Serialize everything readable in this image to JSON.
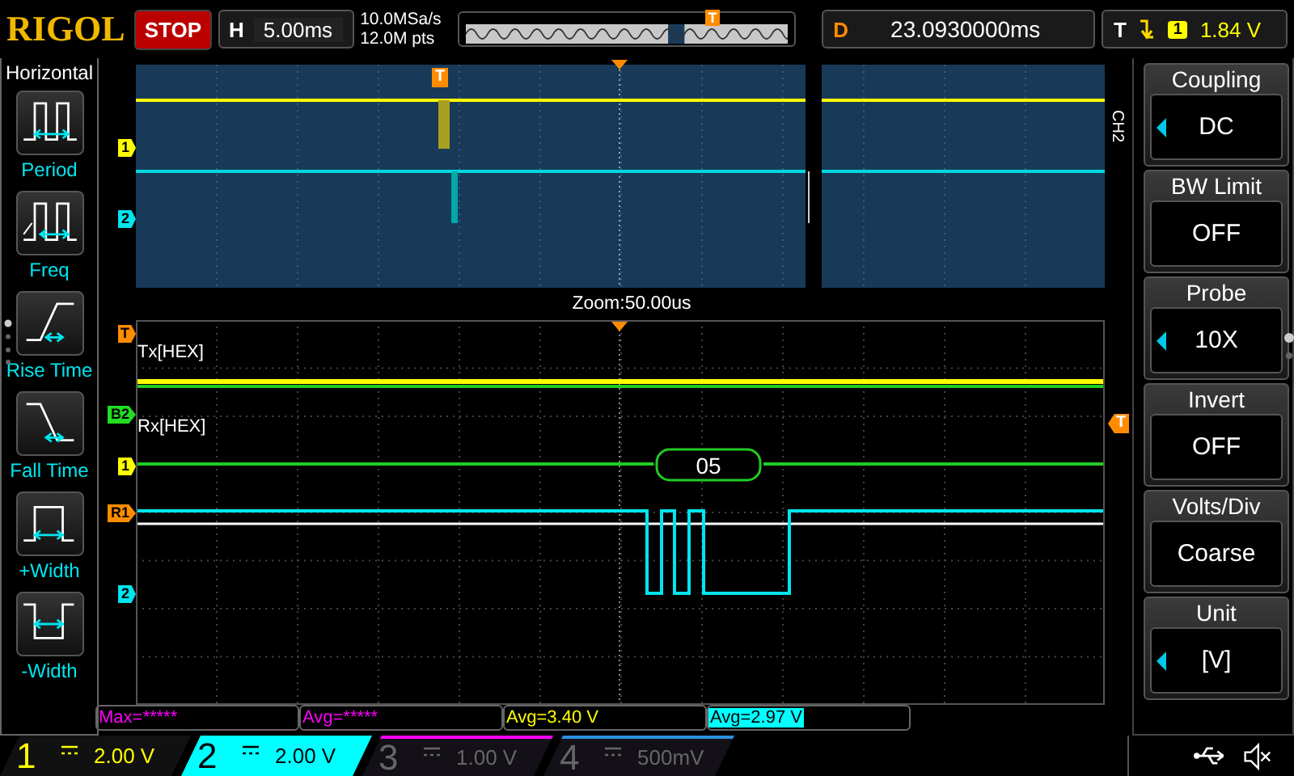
{
  "header": {
    "brand": "RIGOL",
    "run_state": "STOP",
    "timebase_label": "H",
    "timebase": "5.00ms",
    "sample_rate": "10.0MSa/s",
    "memory_depth": "12.0M pts",
    "window_marker": "T",
    "delay_label": "D",
    "delay": "23.0930000ms",
    "trigger_label": "T",
    "trigger_source": "1",
    "trigger_level": "1.84 V"
  },
  "left_menu": {
    "title": "Horizontal",
    "items": [
      {
        "label": "Period",
        "kind": "period"
      },
      {
        "label": "Freq",
        "kind": "freq"
      },
      {
        "label": "Rise Time",
        "kind": "rise"
      },
      {
        "label": "Fall Time",
        "kind": "fall"
      },
      {
        "label": "+Width",
        "kind": "pwidth"
      },
      {
        "label": "-Width",
        "kind": "nwidth"
      }
    ]
  },
  "scope": {
    "overview_trigger": "T",
    "overview_markers": [
      {
        "label": "1",
        "color": "#ffff00"
      },
      {
        "label": "2",
        "color": "#00e5ee"
      }
    ],
    "zoom_label": "Zoom:50.00us",
    "zoom_markers": [
      {
        "label": "T",
        "color": "#ff8c00"
      },
      {
        "label": "B2",
        "color": "#22dd22"
      },
      {
        "label": "1",
        "color": "#ffff00"
      },
      {
        "label": "R1",
        "color": "#ff8c00"
      },
      {
        "label": "2",
        "color": "#00e5ee"
      }
    ],
    "bus_labels": [
      "Tx[HEX]",
      "Rx[HEX]"
    ],
    "decoded_frame": "05",
    "trigger_level_marker": "T",
    "channel_tag": "CH2"
  },
  "measurements": [
    {
      "text": "Max=*****",
      "color": "#ff00ff",
      "highlighted": false
    },
    {
      "text": "Avg=*****",
      "color": "#ff00ff",
      "highlighted": false
    },
    {
      "text": "Avg=3.40 V",
      "color": "#ffff00",
      "highlighted": false
    },
    {
      "text": "Avg=2.97 V",
      "color": "#00ffff",
      "highlighted": true
    }
  ],
  "channels": [
    {
      "number": "1",
      "scale": "2.00 V",
      "color": "#ffff00",
      "selected": false,
      "enabled": true
    },
    {
      "number": "2",
      "scale": "2.00 V",
      "color": "#00ffff",
      "selected": true,
      "enabled": true
    },
    {
      "number": "3",
      "scale": "1.00 V",
      "color": "#ff00ff",
      "selected": false,
      "enabled": false
    },
    {
      "number": "4",
      "scale": "500mV",
      "color": "#2a8fdf",
      "selected": false,
      "enabled": false
    }
  ],
  "right_menu": [
    {
      "title": "Coupling",
      "value": "DC",
      "adjustable": true
    },
    {
      "title": "BW Limit",
      "value": "OFF",
      "adjustable": false
    },
    {
      "title": "Probe",
      "value": "10X",
      "adjustable": true
    },
    {
      "title": "Invert",
      "value": "OFF",
      "adjustable": false
    },
    {
      "title": "Volts/Div",
      "value": "Coarse",
      "adjustable": false
    },
    {
      "title": "Unit",
      "value": "[V]",
      "adjustable": true
    }
  ]
}
